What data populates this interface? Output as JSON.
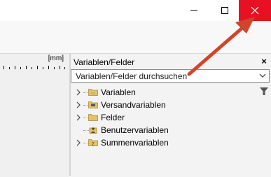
{
  "window": {
    "minimize_icon": "minimize-icon",
    "maximize_icon": "maximize-icon",
    "close_icon": "close-icon",
    "close_color": "#e81123"
  },
  "ruler": {
    "unit": "[mm]"
  },
  "panel": {
    "title": "Variablen/Felder",
    "close_glyph": "×",
    "search": {
      "value": "Variablen/Felder durchsuchen"
    },
    "tree": [
      {
        "label": "Variablen",
        "icon": "variables-folder-icon",
        "expandable": true
      },
      {
        "label": "Versandvariablen",
        "icon": "printer-folder-icon",
        "expandable": true
      },
      {
        "label": "Felder",
        "icon": "folder-icon",
        "expandable": true
      },
      {
        "label": "Benutzervariablen",
        "icon": "user-variables-icon",
        "expandable": false
      },
      {
        "label": "Summenvariablen",
        "icon": "sum-folder-icon",
        "expandable": true
      }
    ]
  },
  "annotation": {
    "arrow_color": "#d0452c"
  }
}
